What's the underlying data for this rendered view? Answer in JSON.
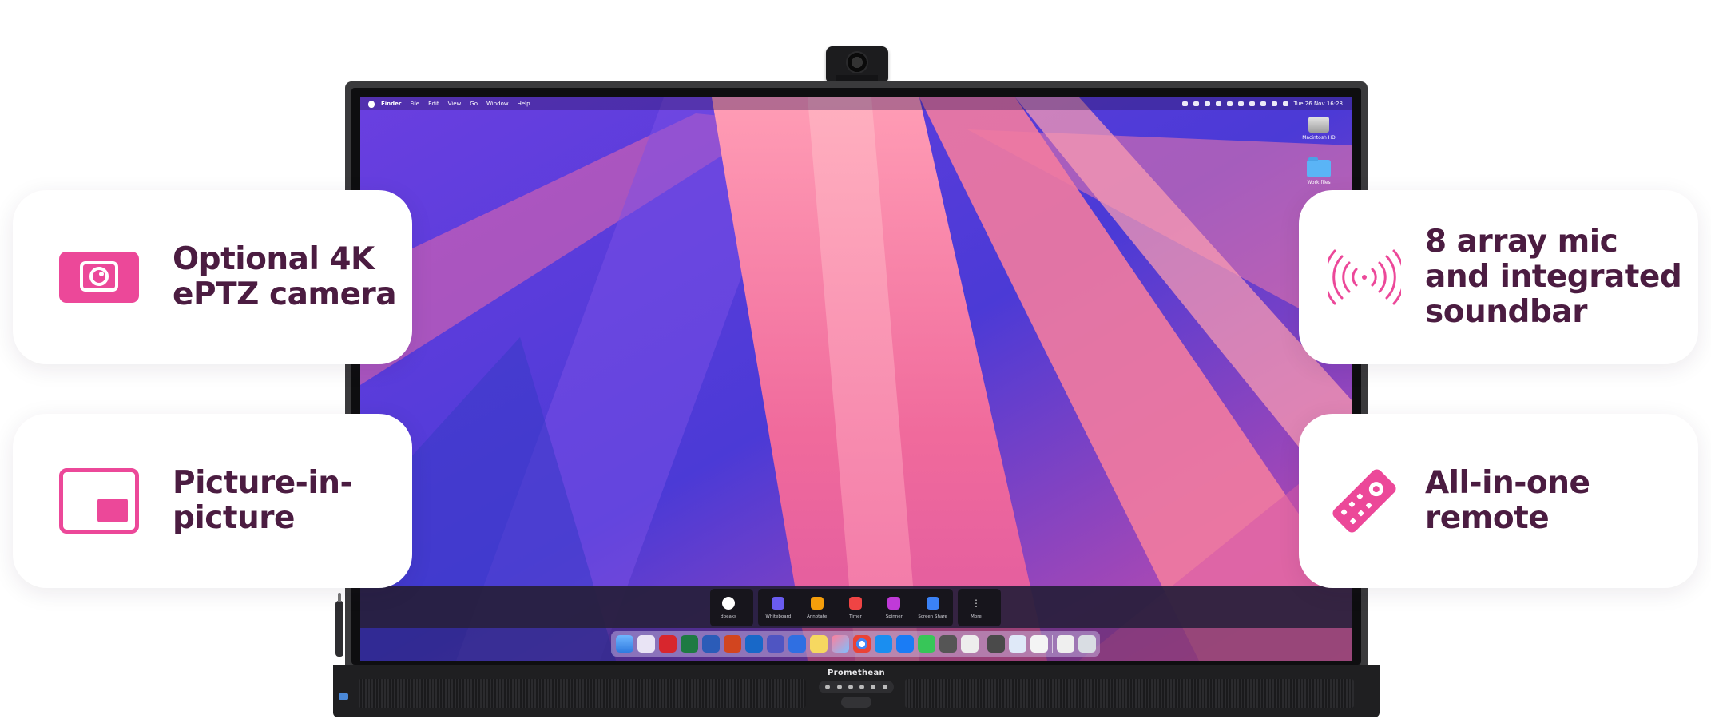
{
  "colors": {
    "accent": "#ec4899",
    "text": "#4b1c41",
    "card_bg": "#ffffff",
    "page_bg": "#ffffff"
  },
  "features": {
    "camera": {
      "label_line1": "Optional 4K",
      "label_line2": "ePTZ camera",
      "icon": "camera-icon"
    },
    "pip": {
      "label_line1": "Picture-in-",
      "label_line2": "picture",
      "icon": "picture-in-picture-icon"
    },
    "mic": {
      "label_line1": "8 array mic",
      "label_line2": "and integrated",
      "label_line3": "soundbar",
      "icon": "microphone-array-icon"
    },
    "remote": {
      "label_line1": "All-in-one",
      "label_line2": "remote",
      "icon": "remote-icon"
    }
  },
  "display": {
    "brand": "Promethean",
    "menubar": {
      "app": "Finder",
      "items": [
        "File",
        "Edit",
        "View",
        "Go",
        "Window",
        "Help"
      ],
      "clock": "Tue 26 Nov 16:28"
    },
    "desktop_icons": [
      {
        "label": "Macintosh HD",
        "icon": "hard-drive-icon"
      },
      {
        "label": "Work files",
        "icon": "folder-icon"
      }
    ],
    "toolbar": {
      "items": [
        {
          "label": "dbeaks",
          "color": "#ffffff"
        },
        {
          "label": "Whiteboard",
          "color": "#6a5cf0"
        },
        {
          "label": "Annotate",
          "color": "#f59e0b"
        },
        {
          "label": "Timer",
          "color": "#ef4444"
        },
        {
          "label": "Spinner",
          "color": "#c03ad8"
        },
        {
          "label": "Screen Share",
          "color": "#3b82f6"
        },
        {
          "label": "More",
          "color": "#999999"
        }
      ]
    }
  }
}
